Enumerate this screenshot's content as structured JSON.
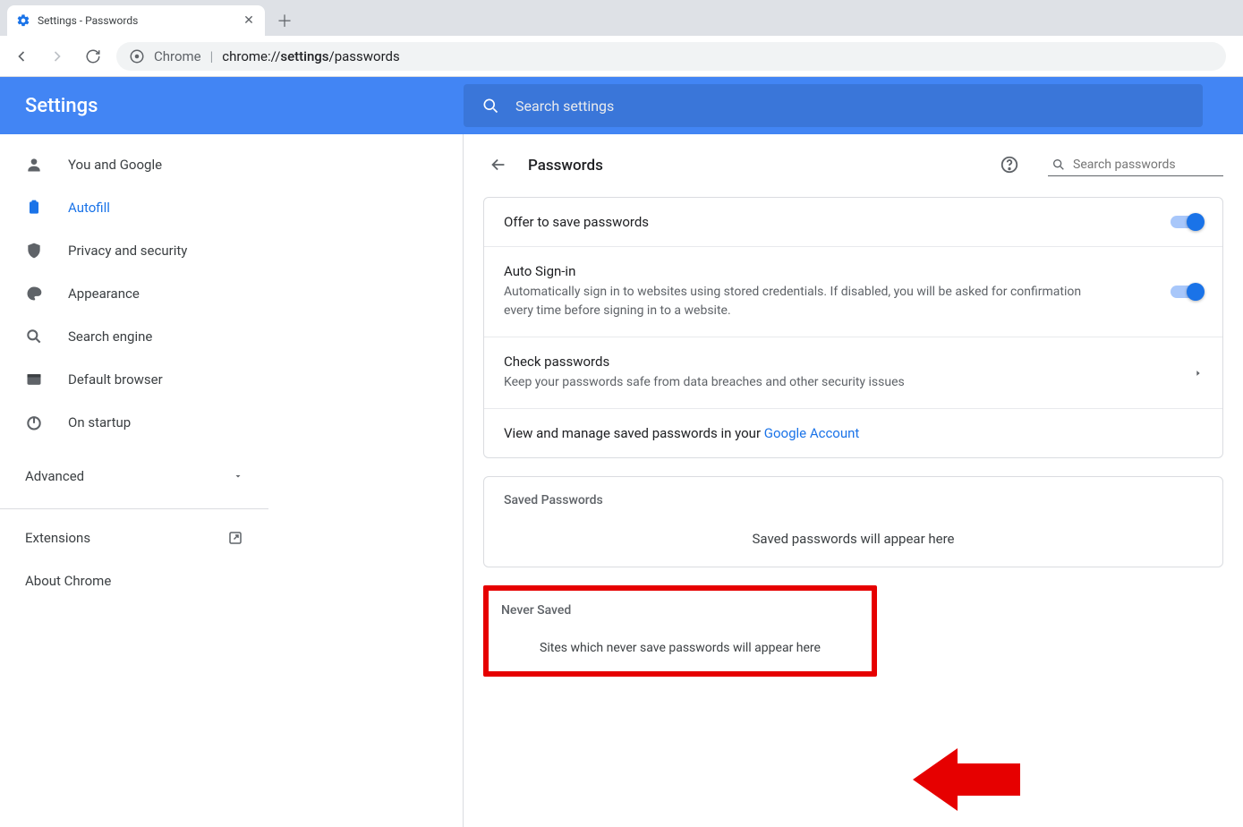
{
  "browser": {
    "tab_title": "Settings - Passwords",
    "omnibox_scheme_label": "Chrome",
    "omnibox_url_prefix": "chrome://",
    "omnibox_url_bold": "settings",
    "omnibox_url_rest": "/passwords"
  },
  "header": {
    "title": "Settings",
    "search_placeholder": "Search settings"
  },
  "sidebar": {
    "items": [
      {
        "label": "You and Google"
      },
      {
        "label": "Autofill"
      },
      {
        "label": "Privacy and security"
      },
      {
        "label": "Appearance"
      },
      {
        "label": "Search engine"
      },
      {
        "label": "Default browser"
      },
      {
        "label": "On startup"
      }
    ],
    "advanced": "Advanced",
    "extensions": "Extensions",
    "about": "About Chrome"
  },
  "page": {
    "title": "Passwords",
    "search_placeholder": "Search passwords",
    "offer_label": "Offer to save passwords",
    "auto_signin_label": "Auto Sign-in",
    "auto_signin_desc": "Automatically sign in to websites using stored credentials. If disabled, you will be asked for confirmation every time before signing in to a website.",
    "check_label": "Check passwords",
    "check_desc": "Keep your passwords safe from data breaches and other security issues",
    "manage_text": "View and manage saved passwords in your ",
    "manage_link": "Google Account",
    "saved_title": "Saved Passwords",
    "saved_empty": "Saved passwords will appear here",
    "never_title": "Never Saved",
    "never_empty": "Sites which never save passwords will appear here"
  }
}
